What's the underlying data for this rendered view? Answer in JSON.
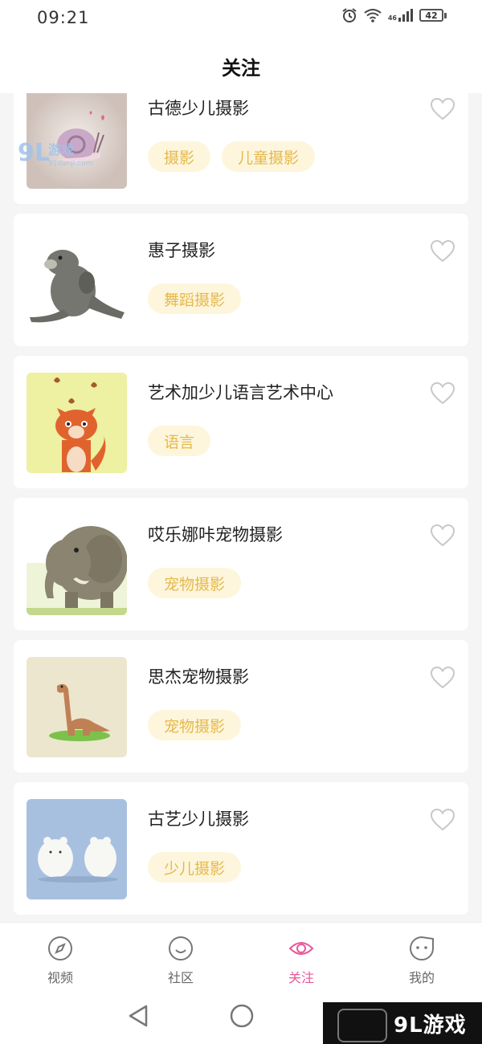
{
  "status_bar": {
    "time": "09:21",
    "network": "46",
    "battery": "42"
  },
  "header": {
    "title": "关注"
  },
  "cards": [
    {
      "name": "古德少儿摄影",
      "tags": [
        "摄影",
        "儿童摄影"
      ],
      "thumb_icon": "snail-icon"
    },
    {
      "name": "惠子摄影",
      "tags": [
        "舞蹈摄影"
      ],
      "thumb_icon": "seal-icon"
    },
    {
      "name": "艺术加少儿语言艺术中心",
      "tags": [
        "语言"
      ],
      "thumb_icon": "fox-icon"
    },
    {
      "name": "哎乐娜咔宠物摄影",
      "tags": [
        "宠物摄影"
      ],
      "thumb_icon": "elephant-icon"
    },
    {
      "name": "思杰宠物摄影",
      "tags": [
        "宠物摄影"
      ],
      "thumb_icon": "dinosaur-icon"
    },
    {
      "name": "古艺少儿摄影",
      "tags": [
        "少儿摄影"
      ],
      "thumb_icon": "polar-bears-icon"
    }
  ],
  "bottom_nav": [
    {
      "label": "视频",
      "icon": "compass-icon"
    },
    {
      "label": "社区",
      "icon": "smile-icon"
    },
    {
      "label": "关注",
      "icon": "eye-icon",
      "active": true
    },
    {
      "label": "我的",
      "icon": "chat-face-icon"
    }
  ],
  "watermark": {
    "top_text": "91danji.com",
    "bottom_text": "9L游戏"
  },
  "colors": {
    "accent": "#e8579a",
    "tag_bg": "#fdf6dc",
    "tag_text": "#e6b84c",
    "background": "#f5f5f5"
  }
}
